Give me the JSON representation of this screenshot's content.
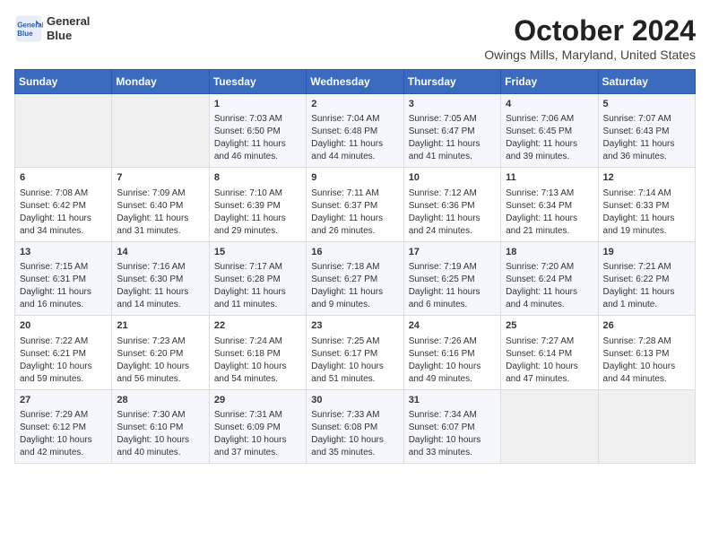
{
  "header": {
    "logo_line1": "General",
    "logo_line2": "Blue",
    "month": "October 2024",
    "location": "Owings Mills, Maryland, United States"
  },
  "weekdays": [
    "Sunday",
    "Monday",
    "Tuesday",
    "Wednesday",
    "Thursday",
    "Friday",
    "Saturday"
  ],
  "weeks": [
    [
      {
        "day": "",
        "info": ""
      },
      {
        "day": "",
        "info": ""
      },
      {
        "day": "1",
        "info": "Sunrise: 7:03 AM\nSunset: 6:50 PM\nDaylight: 11 hours and 46 minutes."
      },
      {
        "day": "2",
        "info": "Sunrise: 7:04 AM\nSunset: 6:48 PM\nDaylight: 11 hours and 44 minutes."
      },
      {
        "day": "3",
        "info": "Sunrise: 7:05 AM\nSunset: 6:47 PM\nDaylight: 11 hours and 41 minutes."
      },
      {
        "day": "4",
        "info": "Sunrise: 7:06 AM\nSunset: 6:45 PM\nDaylight: 11 hours and 39 minutes."
      },
      {
        "day": "5",
        "info": "Sunrise: 7:07 AM\nSunset: 6:43 PM\nDaylight: 11 hours and 36 minutes."
      }
    ],
    [
      {
        "day": "6",
        "info": "Sunrise: 7:08 AM\nSunset: 6:42 PM\nDaylight: 11 hours and 34 minutes."
      },
      {
        "day": "7",
        "info": "Sunrise: 7:09 AM\nSunset: 6:40 PM\nDaylight: 11 hours and 31 minutes."
      },
      {
        "day": "8",
        "info": "Sunrise: 7:10 AM\nSunset: 6:39 PM\nDaylight: 11 hours and 29 minutes."
      },
      {
        "day": "9",
        "info": "Sunrise: 7:11 AM\nSunset: 6:37 PM\nDaylight: 11 hours and 26 minutes."
      },
      {
        "day": "10",
        "info": "Sunrise: 7:12 AM\nSunset: 6:36 PM\nDaylight: 11 hours and 24 minutes."
      },
      {
        "day": "11",
        "info": "Sunrise: 7:13 AM\nSunset: 6:34 PM\nDaylight: 11 hours and 21 minutes."
      },
      {
        "day": "12",
        "info": "Sunrise: 7:14 AM\nSunset: 6:33 PM\nDaylight: 11 hours and 19 minutes."
      }
    ],
    [
      {
        "day": "13",
        "info": "Sunrise: 7:15 AM\nSunset: 6:31 PM\nDaylight: 11 hours and 16 minutes."
      },
      {
        "day": "14",
        "info": "Sunrise: 7:16 AM\nSunset: 6:30 PM\nDaylight: 11 hours and 14 minutes."
      },
      {
        "day": "15",
        "info": "Sunrise: 7:17 AM\nSunset: 6:28 PM\nDaylight: 11 hours and 11 minutes."
      },
      {
        "day": "16",
        "info": "Sunrise: 7:18 AM\nSunset: 6:27 PM\nDaylight: 11 hours and 9 minutes."
      },
      {
        "day": "17",
        "info": "Sunrise: 7:19 AM\nSunset: 6:25 PM\nDaylight: 11 hours and 6 minutes."
      },
      {
        "day": "18",
        "info": "Sunrise: 7:20 AM\nSunset: 6:24 PM\nDaylight: 11 hours and 4 minutes."
      },
      {
        "day": "19",
        "info": "Sunrise: 7:21 AM\nSunset: 6:22 PM\nDaylight: 11 hours and 1 minute."
      }
    ],
    [
      {
        "day": "20",
        "info": "Sunrise: 7:22 AM\nSunset: 6:21 PM\nDaylight: 10 hours and 59 minutes."
      },
      {
        "day": "21",
        "info": "Sunrise: 7:23 AM\nSunset: 6:20 PM\nDaylight: 10 hours and 56 minutes."
      },
      {
        "day": "22",
        "info": "Sunrise: 7:24 AM\nSunset: 6:18 PM\nDaylight: 10 hours and 54 minutes."
      },
      {
        "day": "23",
        "info": "Sunrise: 7:25 AM\nSunset: 6:17 PM\nDaylight: 10 hours and 51 minutes."
      },
      {
        "day": "24",
        "info": "Sunrise: 7:26 AM\nSunset: 6:16 PM\nDaylight: 10 hours and 49 minutes."
      },
      {
        "day": "25",
        "info": "Sunrise: 7:27 AM\nSunset: 6:14 PM\nDaylight: 10 hours and 47 minutes."
      },
      {
        "day": "26",
        "info": "Sunrise: 7:28 AM\nSunset: 6:13 PM\nDaylight: 10 hours and 44 minutes."
      }
    ],
    [
      {
        "day": "27",
        "info": "Sunrise: 7:29 AM\nSunset: 6:12 PM\nDaylight: 10 hours and 42 minutes."
      },
      {
        "day": "28",
        "info": "Sunrise: 7:30 AM\nSunset: 6:10 PM\nDaylight: 10 hours and 40 minutes."
      },
      {
        "day": "29",
        "info": "Sunrise: 7:31 AM\nSunset: 6:09 PM\nDaylight: 10 hours and 37 minutes."
      },
      {
        "day": "30",
        "info": "Sunrise: 7:33 AM\nSunset: 6:08 PM\nDaylight: 10 hours and 35 minutes."
      },
      {
        "day": "31",
        "info": "Sunrise: 7:34 AM\nSunset: 6:07 PM\nDaylight: 10 hours and 33 minutes."
      },
      {
        "day": "",
        "info": ""
      },
      {
        "day": "",
        "info": ""
      }
    ]
  ]
}
